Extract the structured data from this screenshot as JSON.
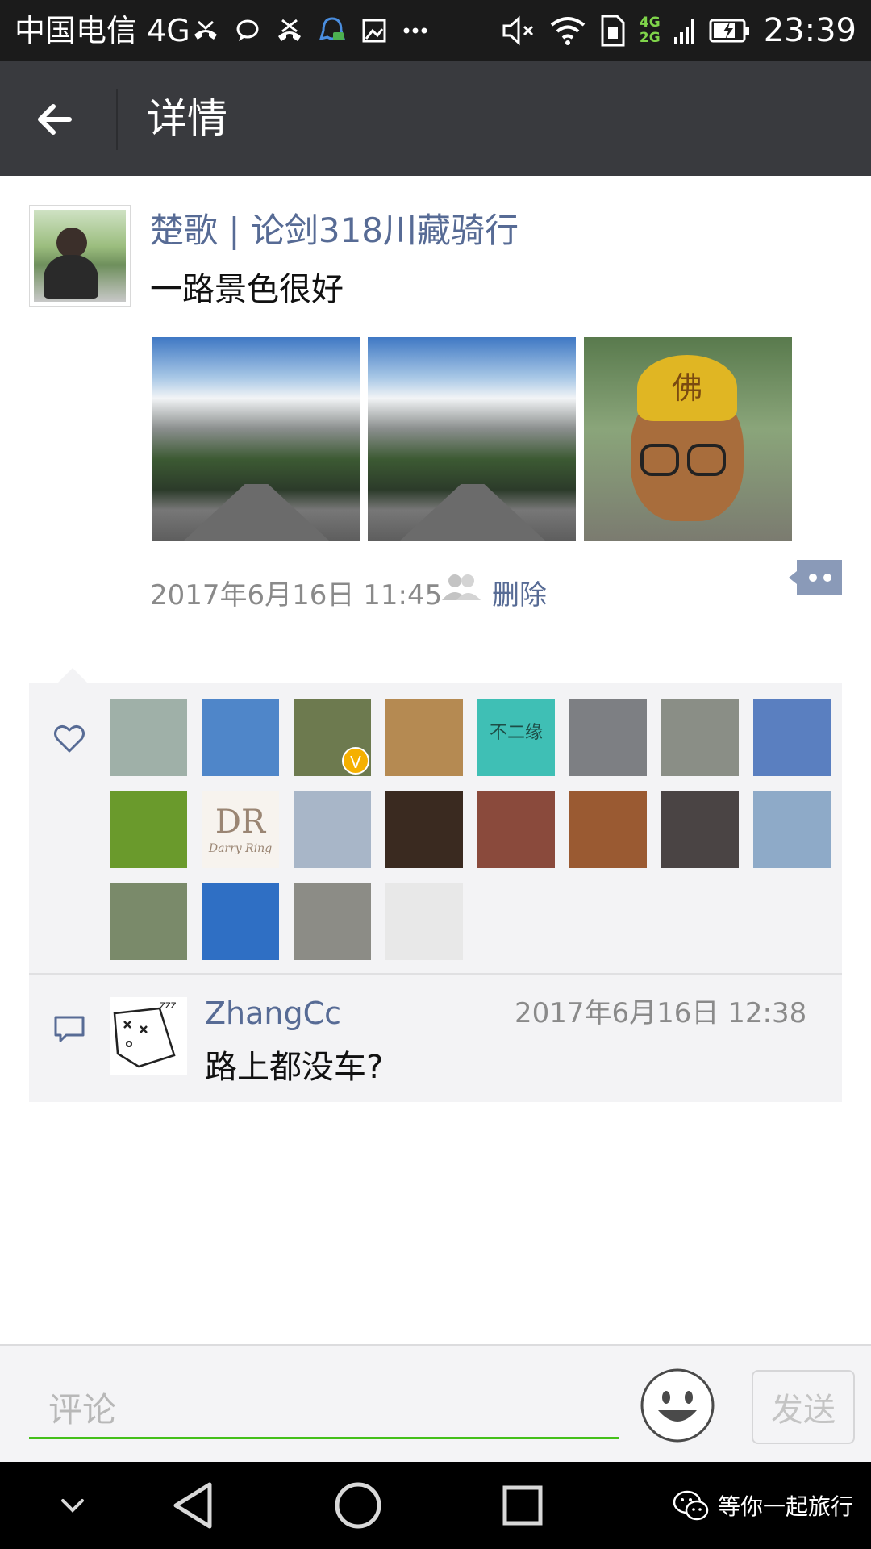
{
  "status_bar": {
    "carrier": "中国电信 4G",
    "network_secondary": "4G",
    "network_tertiary": "2G",
    "time": "23:39"
  },
  "header": {
    "title": "详情"
  },
  "post": {
    "author": "楚歌 | 论剑318川藏骑行",
    "text": "一路景色很好",
    "photos": [
      {
        "icon": "mountain-road-photo"
      },
      {
        "icon": "mountain-road-photo"
      },
      {
        "icon": "monkey-king-mask-photo",
        "caption": "佛"
      }
    ],
    "timestamp": "2017年6月16日 11:45",
    "delete_label": "删除"
  },
  "likes": {
    "avatars": [
      {
        "label": "",
        "color": "#9fb0a8"
      },
      {
        "label": "",
        "color": "#4f86c9"
      },
      {
        "label": "",
        "color": "#6d7a4f",
        "badge": "V"
      },
      {
        "label": "",
        "color": "#b58a52"
      },
      {
        "label": "不二缘",
        "color": "#3fbfb5"
      },
      {
        "label": "",
        "color": "#7d7f83"
      },
      {
        "label": "",
        "color": "#8a8e86"
      },
      {
        "label": "",
        "color": "#5a7fc0"
      },
      {
        "label": "",
        "color": "#6a9a2c"
      },
      {
        "label": "DR",
        "sub": "Darry Ring",
        "color": "#f7f3ee"
      },
      {
        "label": "",
        "color": "#a8b6c8"
      },
      {
        "label": "",
        "color": "#3a2a20"
      },
      {
        "label": "",
        "color": "#8a4a3c"
      },
      {
        "label": "",
        "color": "#9a5a32"
      },
      {
        "label": "",
        "color": "#4a4444"
      },
      {
        "label": "",
        "color": "#8eaac8"
      },
      {
        "label": "",
        "color": "#7a8a6a"
      },
      {
        "label": "",
        "color": "#2f6fc4"
      },
      {
        "label": "",
        "color": "#8c8c86"
      },
      {
        "label": "",
        "color": "#e8e8e8"
      }
    ]
  },
  "comments": [
    {
      "name": "ZhangCc",
      "time": "2017年6月16日 12:38",
      "text": "路上都没车?"
    }
  ],
  "input": {
    "placeholder": "评论",
    "send_label": "发送"
  },
  "watermark": {
    "text": "等你一起旅行"
  },
  "colors": {
    "link": "#576b95",
    "header_bg": "#393a3e",
    "accent_green": "#45c01a"
  }
}
